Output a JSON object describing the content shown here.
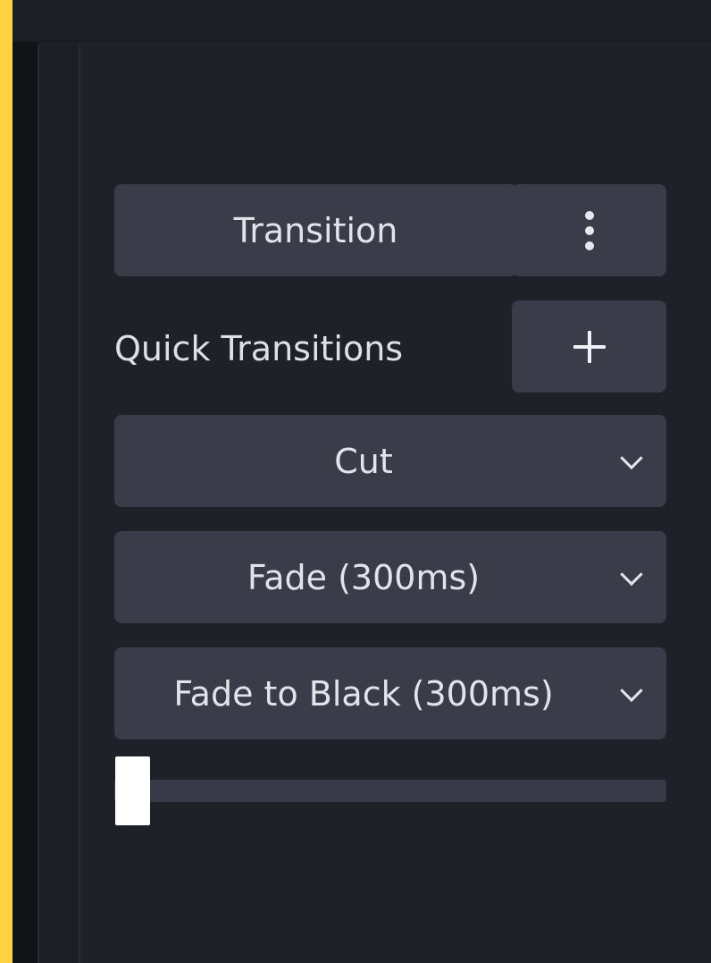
{
  "panel": {
    "transition_button_label": "Transition",
    "quick_transitions_label": "Quick Transitions",
    "transitions": [
      {
        "label": "Cut"
      },
      {
        "label": "Fade (300ms)"
      },
      {
        "label": "Fade to Black (300ms)"
      }
    ],
    "slider_value": 0,
    "icons": {
      "menu": "more-vertical-icon",
      "add": "plus-icon",
      "dropdown": "chevron-down-icon"
    }
  },
  "colors": {
    "background": "#1f2129",
    "button": "#3b3c4a",
    "text": "#e3e4ea",
    "frame": "#ffd23f",
    "slider_thumb": "#ffffff"
  }
}
